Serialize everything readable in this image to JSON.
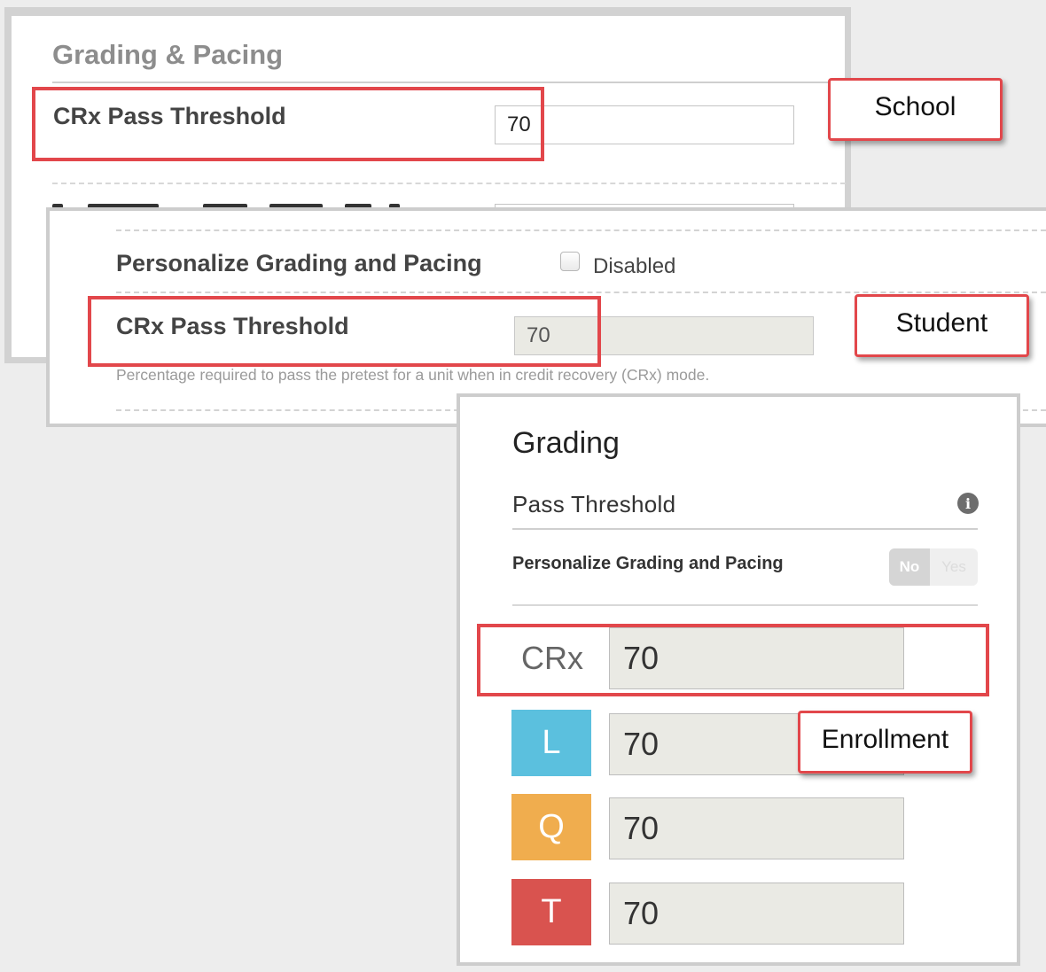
{
  "school": {
    "section_title": "Grading & Pacing",
    "crx_label": "CRx Pass Threshold",
    "crx_value": "70",
    "callout": "School"
  },
  "student": {
    "personalize_label": "Personalize Grading and Pacing",
    "personalize_checked": false,
    "personalize_state": "Disabled",
    "crx_label": "CRx Pass Threshold",
    "crx_value": "70",
    "help_text": "Percentage required to pass the pretest for a unit when in credit recovery (CRx) mode.",
    "callout": "Student"
  },
  "enrollment": {
    "title": "Grading",
    "subtitle": "Pass Threshold",
    "info_icon": "info-icon",
    "personalize_label": "Personalize Grading and Pacing",
    "toggle": {
      "no": "No",
      "yes": "Yes",
      "selected": "No"
    },
    "rows": [
      {
        "label": "CRx",
        "value": "70",
        "color": "#ffffff"
      },
      {
        "label": "L",
        "value": "70",
        "color": "#5bc0de"
      },
      {
        "label": "Q",
        "value": "70",
        "color": "#f0ad4e"
      },
      {
        "label": "T",
        "value": "70",
        "color": "#d9534f"
      }
    ],
    "callout": "Enrollment"
  },
  "colors": {
    "highlight": "#e2474b",
    "background": "#ededed"
  }
}
